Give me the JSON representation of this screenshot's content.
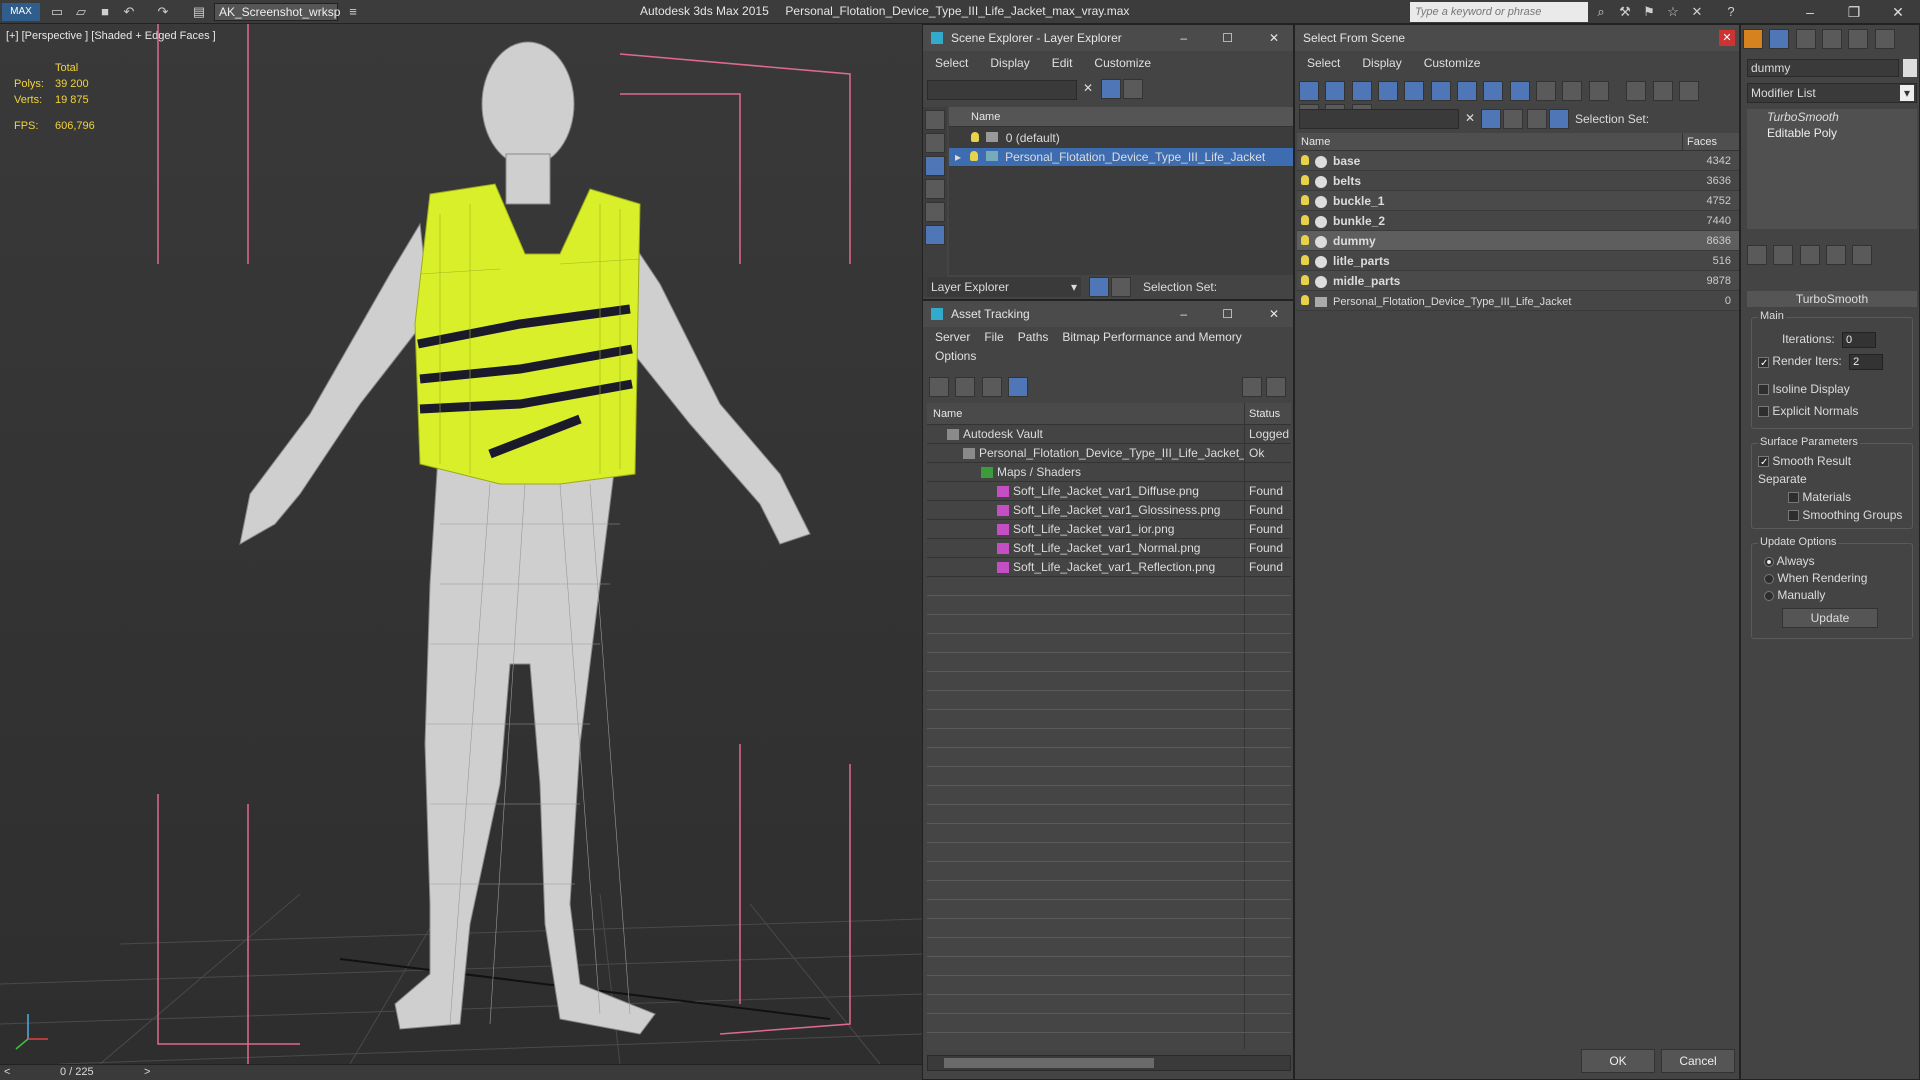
{
  "titlebar": {
    "workspace": "AK_Screenshot_wrksp",
    "app_name": "Autodesk 3ds Max  2015",
    "file_name": "Personal_Flotation_Device_Type_III_Life_Jacket_max_vray.max",
    "search_placeholder": "Type a keyword or phrase"
  },
  "viewport": {
    "label": "[+] [Perspective ] [Shaded + Edged Faces ]",
    "stats": {
      "total_label": "Total",
      "polys_label": "Polys:",
      "polys_value": "39 200",
      "verts_label": "Verts:",
      "verts_value": "19 875",
      "fps_label": "FPS:",
      "fps_value": "606,796"
    }
  },
  "statusbar": {
    "frame": "0 / 225",
    "prev": "<",
    "next": ">"
  },
  "scene_explorer": {
    "title": "Scene Explorer - Layer Explorer",
    "menu": [
      "Select",
      "Display",
      "Edit",
      "Customize"
    ],
    "column": "Name",
    "rows": [
      {
        "label": "0 (default)"
      },
      {
        "label": "Personal_Flotation_Device_Type_III_Life_Jacket"
      }
    ],
    "footer_dropdown": "Layer Explorer",
    "selection_set": "Selection Set:"
  },
  "asset_tracking": {
    "title": "Asset Tracking",
    "menu": [
      "Server",
      "File",
      "Paths",
      "Bitmap Performance and Memory"
    ],
    "menu2": "Options",
    "col_name": "Name",
    "col_status": "Status",
    "rows": [
      {
        "name": "Autodesk Vault",
        "status": "Logged"
      },
      {
        "name": "Personal_Flotation_Device_Type_III_Life_Jacket_...",
        "status": "Ok"
      },
      {
        "name": "Maps / Shaders",
        "status": ""
      },
      {
        "name": "Soft_Life_Jacket_var1_Diffuse.png",
        "status": "Found"
      },
      {
        "name": "Soft_Life_Jacket_var1_Glossiness.png",
        "status": "Found"
      },
      {
        "name": "Soft_Life_Jacket_var1_ior.png",
        "status": "Found"
      },
      {
        "name": "Soft_Life_Jacket_var1_Normal.png",
        "status": "Found"
      },
      {
        "name": "Soft_Life_Jacket_var1_Reflection.png",
        "status": "Found"
      }
    ]
  },
  "select_from_scene": {
    "title": "Select From Scene",
    "menu": [
      "Select",
      "Display",
      "Customize"
    ],
    "selection_set": "Selection Set:",
    "col_name": "Name",
    "col_faces": "Faces",
    "rows": [
      {
        "name": "base",
        "faces": "4342"
      },
      {
        "name": "belts",
        "faces": "3636"
      },
      {
        "name": "buckle_1",
        "faces": "4752"
      },
      {
        "name": "bunkle_2",
        "faces": "7440"
      },
      {
        "name": "dummy",
        "faces": "8636"
      },
      {
        "name": "litle_parts",
        "faces": "516"
      },
      {
        "name": "midle_parts",
        "faces": "9878"
      },
      {
        "name": "Personal_Flotation_Device_Type_III_Life_Jacket",
        "faces": "0"
      }
    ],
    "ok": "OK",
    "cancel": "Cancel"
  },
  "modify_panel": {
    "object_name": "dummy",
    "modifier_list": "Modifier List",
    "stack": [
      "TurboSmooth",
      "Editable Poly"
    ],
    "rollout_title": "TurboSmooth",
    "main_group": "Main",
    "iterations_label": "Iterations:",
    "iterations_value": "0",
    "render_iters_label": "Render Iters:",
    "render_iters_value": "2",
    "isoline": "Isoline Display",
    "explicit_normals": "Explicit Normals",
    "surface_group": "Surface Parameters",
    "smooth_result": "Smooth Result",
    "separate": "Separate",
    "materials": "Materials",
    "smoothing_groups": "Smoothing Groups",
    "update_group": "Update Options",
    "always": "Always",
    "when_rendering": "When Rendering",
    "manually": "Manually",
    "update_btn": "Update"
  }
}
